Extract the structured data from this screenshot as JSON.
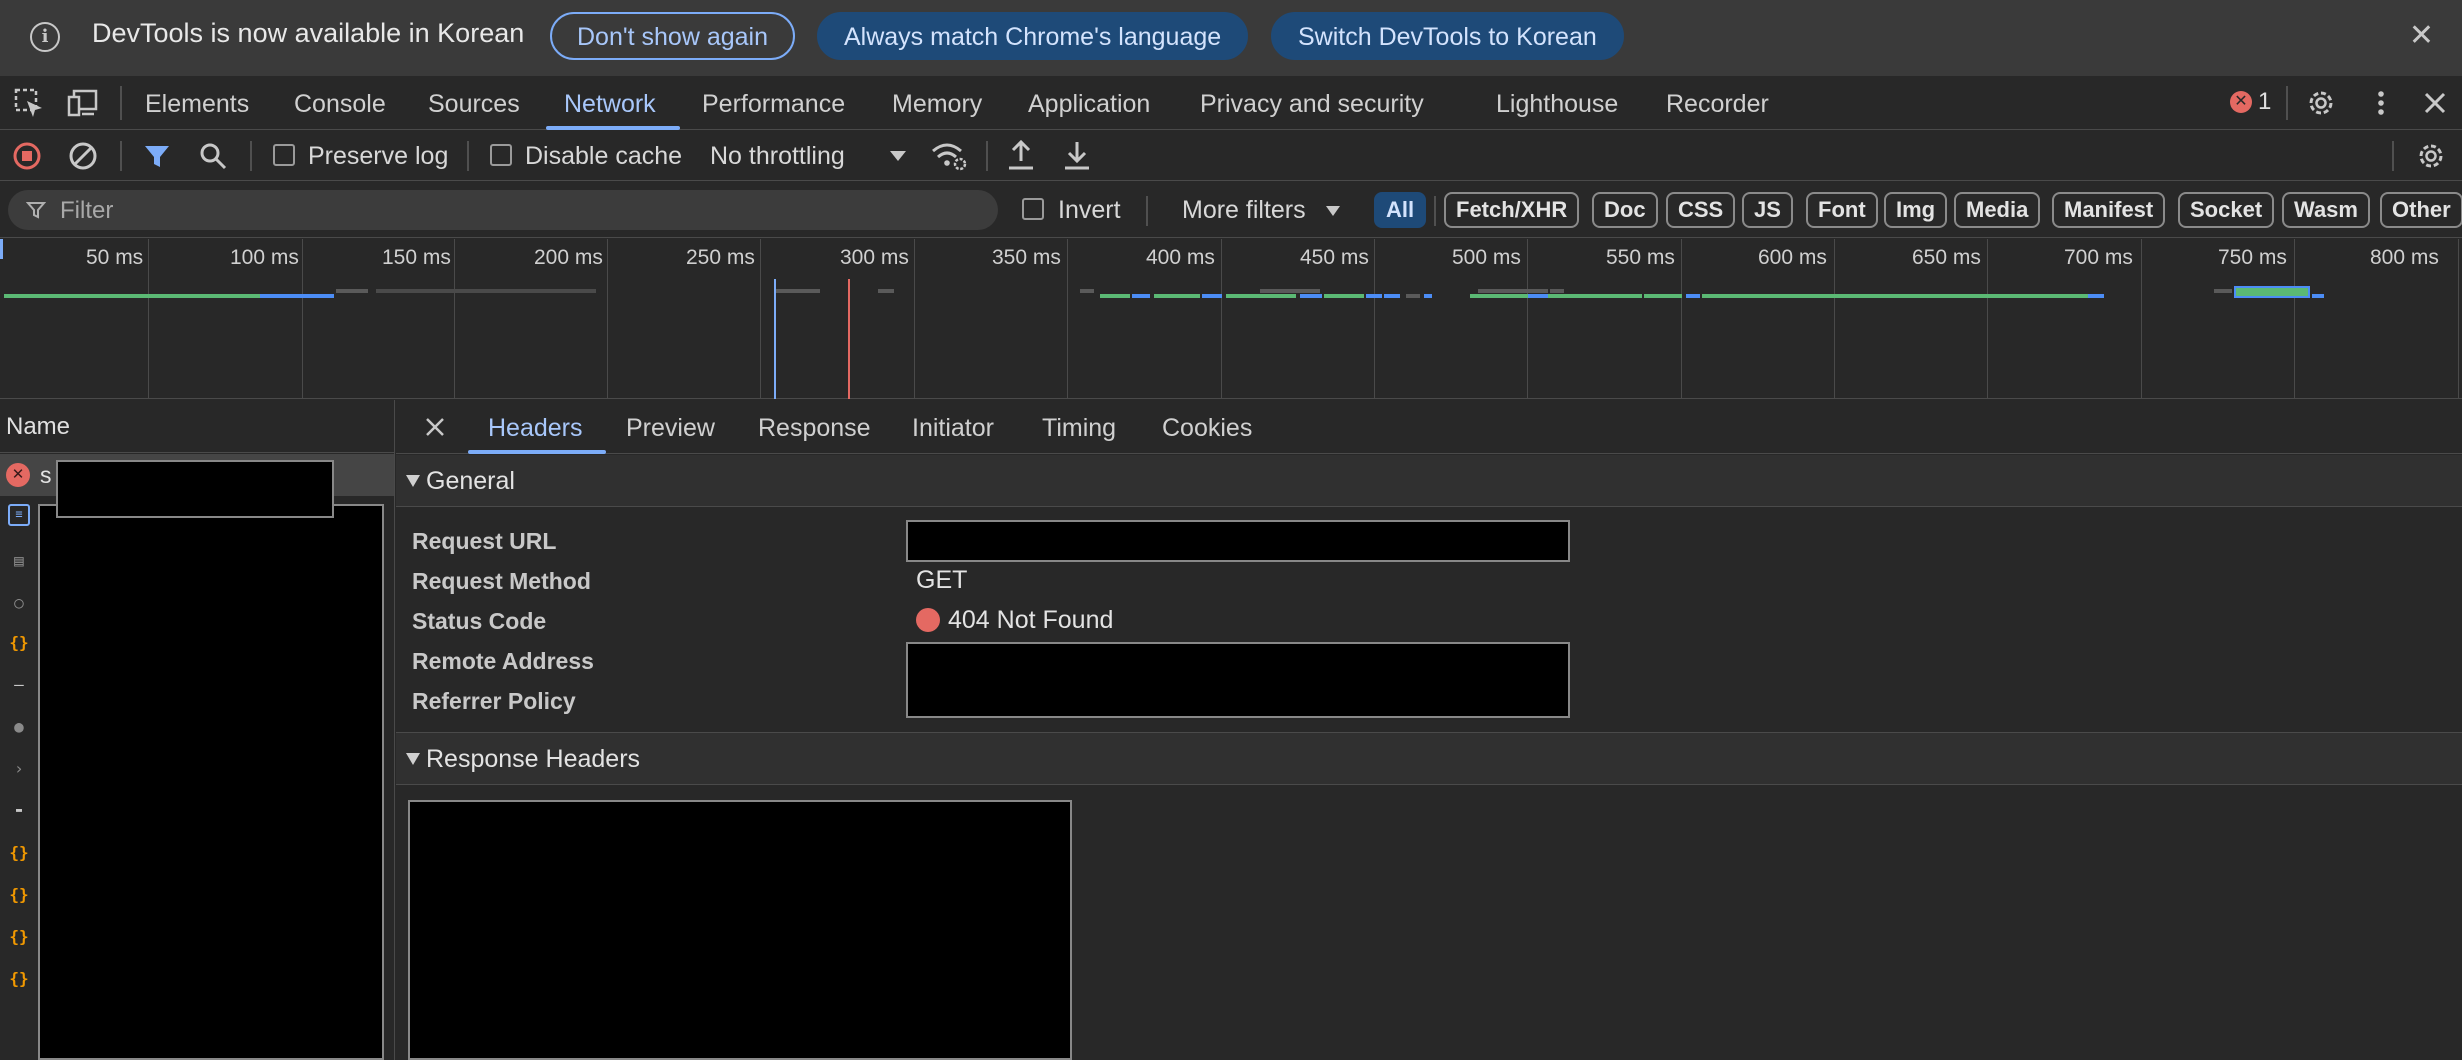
{
  "infobar": {
    "message": "DevTools is now available in Korean",
    "dont_show": "Don't show again",
    "always_match": "Always match Chrome's language",
    "switch": "Switch DevTools to Korean",
    "close_glyph": "✕"
  },
  "tabs": [
    {
      "label": "Elements"
    },
    {
      "label": "Console"
    },
    {
      "label": "Sources"
    },
    {
      "label": "Network"
    },
    {
      "label": "Performance"
    },
    {
      "label": "Memory"
    },
    {
      "label": "Application"
    },
    {
      "label": "Privacy and security"
    },
    {
      "label": "Lighthouse"
    },
    {
      "label": "Recorder"
    }
  ],
  "active_tab": "Network",
  "error_count": "1",
  "toolbar": {
    "preserve_log": "Preserve log",
    "disable_cache": "Disable cache",
    "throttling": "No throttling"
  },
  "filter": {
    "placeholder": "Filter",
    "invert": "Invert",
    "more_filters": "More filters",
    "chips": [
      "All",
      "Fetch/XHR",
      "Doc",
      "CSS",
      "JS",
      "Font",
      "Img",
      "Media",
      "Manifest",
      "Socket",
      "Wasm",
      "Other"
    ],
    "active_chip": "All"
  },
  "timeline": {
    "ticks": [
      "50 ms",
      "100 ms",
      "150 ms",
      "200 ms",
      "250 ms",
      "300 ms",
      "350 ms",
      "400 ms",
      "450 ms",
      "500 ms",
      "550 ms",
      "600 ms",
      "650 ms",
      "700 ms",
      "750 ms",
      "800 ms"
    ]
  },
  "name_column": {
    "header": "Name",
    "first_row_prefix": "s"
  },
  "details": {
    "tabs": [
      "Headers",
      "Preview",
      "Response",
      "Initiator",
      "Timing",
      "Cookies"
    ],
    "active_tab": "Headers",
    "general_title": "General",
    "request_url_label": "Request URL",
    "request_method_label": "Request Method",
    "request_method_value": "GET",
    "status_code_label": "Status Code",
    "status_code_value": "404 Not Found",
    "remote_address_label": "Remote Address",
    "referrer_policy_label": "Referrer Policy",
    "response_headers_title": "Response Headers"
  },
  "colors": {
    "accent": "#7cacf8",
    "error": "#e46962",
    "waterfall_green": "#5bb974",
    "waterfall_blue": "#4c8df6"
  }
}
